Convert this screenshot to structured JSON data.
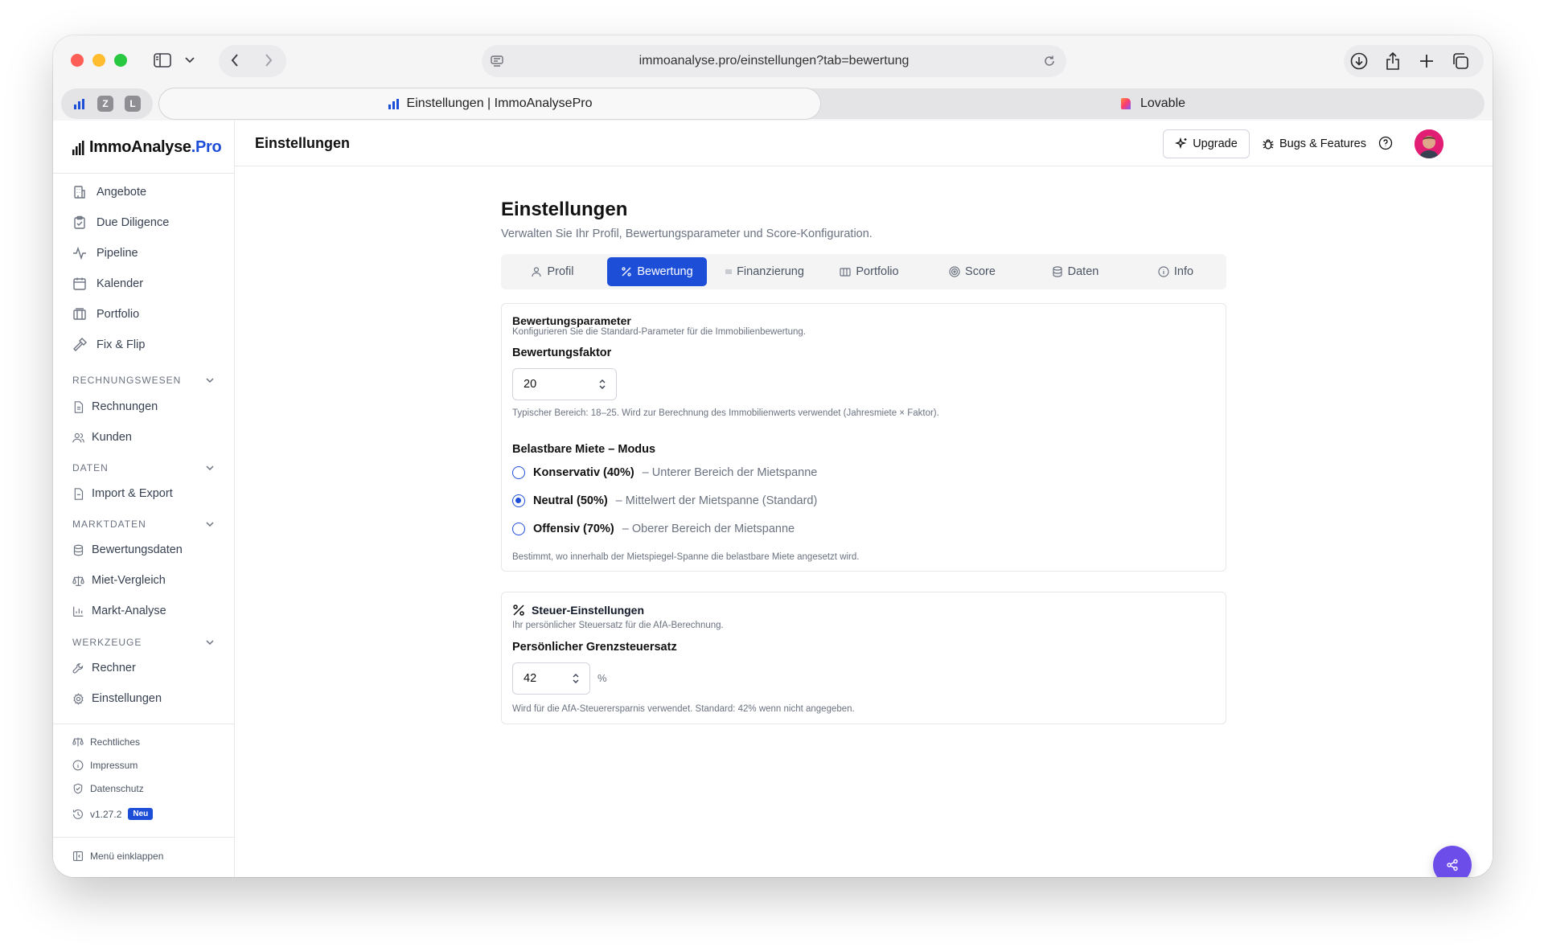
{
  "browser": {
    "url": "immoanalyse.pro/einstellungen?tab=bewertung",
    "profile_badges": [
      "Z",
      "L"
    ],
    "tabs": [
      {
        "label": "Einstellungen | ImmoAnalysePro",
        "active": true
      },
      {
        "label": "Lovable",
        "active": false
      }
    ]
  },
  "brand": {
    "name_main": "ImmoAnalyse",
    "name_suffix": ".Pro",
    "accent": "#1d4ed8"
  },
  "sidebar": {
    "main_items": [
      {
        "label": "Angebote",
        "icon": "building-icon"
      },
      {
        "label": "Due Diligence",
        "icon": "clipboard-check-icon"
      },
      {
        "label": "Pipeline",
        "icon": "activity-icon"
      },
      {
        "label": "Kalender",
        "icon": "calendar-icon"
      },
      {
        "label": "Portfolio",
        "icon": "library-icon"
      },
      {
        "label": "Fix & Flip",
        "icon": "hammer-icon"
      }
    ],
    "sections": [
      {
        "title": "RECHNUNGSWESEN",
        "items": [
          {
            "label": "Rechnungen",
            "icon": "file-text-icon"
          },
          {
            "label": "Kunden",
            "icon": "users-icon"
          }
        ]
      },
      {
        "title": "DATEN",
        "items": [
          {
            "label": "Import & Export",
            "icon": "file-icon"
          }
        ]
      },
      {
        "title": "MARKTDATEN",
        "items": [
          {
            "label": "Bewertungsdaten",
            "icon": "database-icon"
          },
          {
            "label": "Miet-Vergleich",
            "icon": "scale-icon"
          },
          {
            "label": "Markt-Analyse",
            "icon": "bar-chart-icon"
          }
        ]
      },
      {
        "title": "WERKZEUGE",
        "items": [
          {
            "label": "Rechner",
            "icon": "wrench-icon"
          },
          {
            "label": "Einstellungen",
            "icon": "settings-icon"
          }
        ]
      }
    ],
    "footer_links": [
      {
        "label": "Rechtliches",
        "icon": "scale-icon"
      },
      {
        "label": "Impressum",
        "icon": "info-icon"
      },
      {
        "label": "Datenschutz",
        "icon": "shield-icon"
      }
    ],
    "version": "v1.27.2",
    "version_badge": "Neu",
    "collapse_label": "Menü einklappen"
  },
  "topbar": {
    "title": "Einstellungen",
    "upgrade_label": "Upgrade",
    "bugs_label": "Bugs & Features"
  },
  "page": {
    "title": "Einstellungen",
    "subtitle": "Verwalten Sie Ihr Profil, Bewertungsparameter und Score-Konfiguration.",
    "tabs": [
      {
        "label": "Profil",
        "icon": "user-icon"
      },
      {
        "label": "Bewertung",
        "icon": "percent-icon",
        "active": true
      },
      {
        "label": "Finanzierung",
        "icon": "list-icon"
      },
      {
        "label": "Portfolio",
        "icon": "library-icon"
      },
      {
        "label": "Score",
        "icon": "target-icon"
      },
      {
        "label": "Daten",
        "icon": "database-icon"
      },
      {
        "label": "Info",
        "icon": "info-icon"
      }
    ]
  },
  "valuation_card": {
    "title": "Bewertungsparameter",
    "description": "Konfigurieren Sie die Standard-Parameter für die Immobilienbewertung.",
    "factor_label": "Bewertungsfaktor",
    "factor_value": "20",
    "factor_hint": "Typischer Bereich: 18–25. Wird zur Berechnung des Immobilienwerts verwendet (Jahresmiete × Faktor).",
    "rent_mode_label": "Belastbare Miete – Modus",
    "rent_modes": [
      {
        "label": "Konservativ (40%)",
        "desc": "– Unterer Bereich der Mietspanne",
        "selected": false
      },
      {
        "label": "Neutral (50%)",
        "desc": "– Mittelwert der Mietspanne (Standard)",
        "selected": true
      },
      {
        "label": "Offensiv (70%)",
        "desc": "– Oberer Bereich der Mietspanne",
        "selected": false
      }
    ],
    "rent_mode_hint": "Bestimmt, wo innerhalb der Mietspiegel-Spanne die belastbare Miete angesetzt wird."
  },
  "tax_card": {
    "title": "Steuer-Einstellungen",
    "description": "Ihr persönlicher Steuersatz für die AfA-Berechnung.",
    "rate_label": "Persönlicher Grenzsteuersatz",
    "rate_value": "42",
    "rate_unit": "%",
    "rate_hint": "Wird für die AfA-Steuerersparnis verwendet. Standard: 42% wenn nicht angegeben."
  }
}
